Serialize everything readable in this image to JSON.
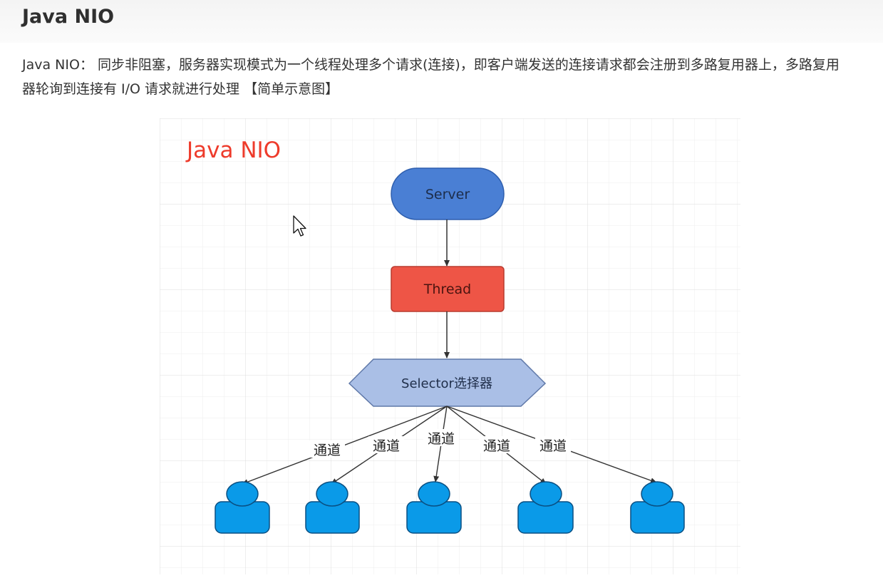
{
  "page": {
    "title": "Java NIO",
    "paragraph": "Java NIO： 同步非阻塞，服务器实现模式为一个线程处理多个请求(连接)，即客户端发送的连接请求都会注册到多路复用器上，多路复用器轮询到连接有 I/O 请求就进行处理 【简单示意图】"
  },
  "diagram": {
    "title": "Java NIO",
    "server_label": "Server",
    "thread_label": "Thread",
    "selector_label": "Selector选择器",
    "channel_labels": [
      "通道",
      "通道",
      "通道",
      "通道",
      "通道"
    ],
    "client_count": 5,
    "colors": {
      "title": "#ee3b2b",
      "server": "#4a7fd4",
      "thread": "#ee5546",
      "selector": "#aabfe6",
      "client": "#0a9ae8"
    }
  }
}
